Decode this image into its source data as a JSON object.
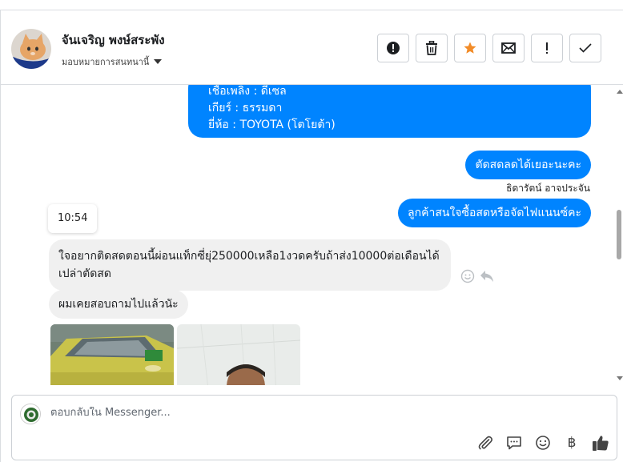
{
  "header": {
    "contact_name": "จันเจริญ พงษ์สระพัง",
    "assign_label": "มอบหมายการสนทนานี้",
    "actions": [
      {
        "name": "spam-button",
        "icon": "exclamation-circle-icon"
      },
      {
        "name": "delete-button",
        "icon": "trash-icon"
      },
      {
        "name": "star-button",
        "icon": "star-icon"
      },
      {
        "name": "mark-unread-button",
        "icon": "envelope-icon"
      },
      {
        "name": "follow-up-button",
        "icon": "exclamation-icon"
      },
      {
        "name": "done-button",
        "icon": "checkmark-icon"
      }
    ]
  },
  "messages": {
    "info_lines": [
      "เชื้อเพลิง : ดีเซล",
      "เกียร์ : ธรรมดา",
      "ยี่ห้อ : TOYOTA (โตโยต้า)"
    ],
    "out_1": "ตัดสดลดได้เยอะนะคะ",
    "sender_name": "ธิดารัตน์ อาจประจัน",
    "out_2": "ลูกค้าสนใจซื้อสดหรือจัดไฟแนนซ์คะ",
    "timestamp": "10:54",
    "in_1": "ใจอยากติดสดตอนนี้ผ่อนแท็กซี่ยุ่250000เหลือ1งวดครับถ้าส่ง10000ต่อเดือนได้เปล่าตัดสด",
    "in_2": "ผมเคยสอบถามไปแล้วนัะ"
  },
  "composer": {
    "placeholder": "ตอบกลับใน Messenger...",
    "tools": [
      "paperclip-icon",
      "speech-bubble-icon",
      "smiley-icon",
      "baht-icon",
      "thumbs-up-icon"
    ],
    "baht_symbol": "฿"
  },
  "colors": {
    "outgoing_bubble": "#0084ff",
    "incoming_bubble": "#f0f0f0",
    "star": "#f28c28"
  }
}
